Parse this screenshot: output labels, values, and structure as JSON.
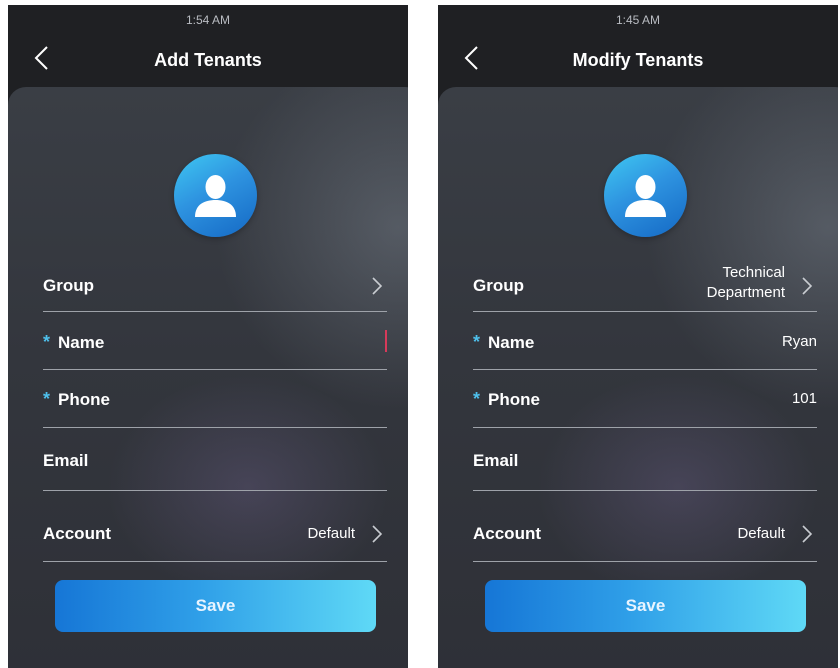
{
  "colors": {
    "background": "#1f2023",
    "panel": "#363940",
    "accent": "#4ec0ec",
    "button_start": "#1676d6",
    "button_end": "#5fd9f6",
    "caret": "#d63a5a"
  },
  "left": {
    "status_time": "1:54 AM",
    "title": "Add Tenants",
    "back_icon": "chevron-left-icon",
    "avatar_icon": "user-avatar-icon",
    "group_label": "Group",
    "name_label": "Name",
    "phone_label": "Phone",
    "email_label": "Email",
    "account_label": "Account",
    "account_value": "Default",
    "required_mark": "*",
    "save_label": "Save"
  },
  "right": {
    "status_time": "1:45 AM",
    "title": "Modify Tenants",
    "back_icon": "chevron-left-icon",
    "avatar_icon": "user-avatar-icon",
    "group_label": "Group",
    "group_value_line1": "Technical",
    "group_value_line2": "Department",
    "name_label": "Name",
    "name_value": "Ryan",
    "phone_label": "Phone",
    "phone_value": "101",
    "email_label": "Email",
    "account_label": "Account",
    "account_value": "Default",
    "required_mark": "*",
    "save_label": "Save"
  }
}
